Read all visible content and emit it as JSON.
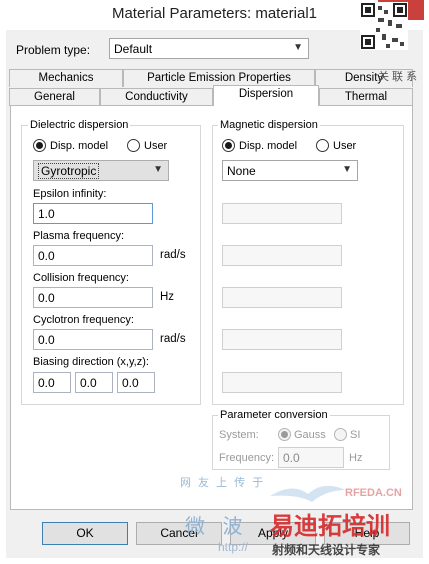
{
  "window": {
    "title": "Material Parameters: material1",
    "close_glyph": "✕"
  },
  "problem_type": {
    "label": "Problem type:",
    "value": "Default"
  },
  "tabs_back": [
    "Mechanics",
    "Particle Emission Properties",
    "Density"
  ],
  "tabs_front": [
    "General",
    "Conductivity",
    "Dispersion",
    "Thermal"
  ],
  "dielectric": {
    "title": "Dielectric dispersion",
    "radio_model": "Disp. model",
    "radio_user": "User",
    "model_value": "Gyrotropic",
    "epsilon_label": "Epsilon infinity:",
    "epsilon_value": "1.0",
    "plasma_label": "Plasma frequency:",
    "plasma_value": "0.0",
    "plasma_unit": "rad/s",
    "collision_label": "Collision frequency:",
    "collision_value": "0.0",
    "collision_unit": "Hz",
    "cyclotron_label": "Cyclotron frequency:",
    "cyclotron_value": "0.0",
    "cyclotron_unit": "rad/s",
    "biasing_label": "Biasing direction (x,y,z):",
    "biasing_x": "0.0",
    "biasing_y": "0.0",
    "biasing_z": "0.0"
  },
  "magnetic": {
    "title": "Magnetic dispersion",
    "radio_model": "Disp. model",
    "radio_user": "User",
    "model_value": "None"
  },
  "conversion": {
    "title": "Parameter conversion",
    "system_label": "System:",
    "gauss": "Gauss",
    "si": "SI",
    "frequency_label": "Frequency:",
    "frequency_value": "0.0",
    "frequency_unit": "Hz"
  },
  "buttons": {
    "ok": "OK",
    "cancel": "Cancel",
    "apply": "Apply",
    "help": "Help"
  },
  "watermarks": {
    "rfeda": "RFEDA.CN",
    "cn_top": "网 友 上 传 于",
    "cn_mid": "微 波",
    "url": "http://",
    "cn_big": "易迪拓培训",
    "cn_sub": "射频和天线设计专家",
    "qr_text": "关 联 系"
  }
}
